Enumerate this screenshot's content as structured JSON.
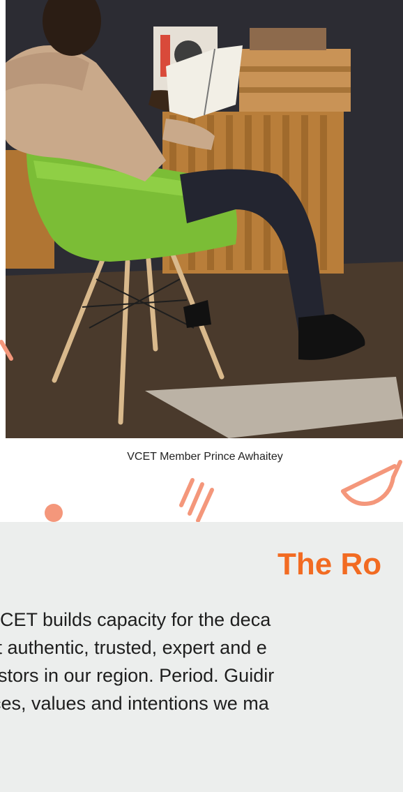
{
  "photo": {
    "alt": "Man reading a book in a green chair",
    "icon": "photo"
  },
  "caption": "VCET Member Prince Awhaitey",
  "section": {
    "title": "The Ro",
    "body_lines": [
      "VCET builds capacity for the deca",
      "st authentic, trusted, expert and e",
      "estors in our region. Period. Guidir",
      "ices, values and intentions we ma"
    ]
  },
  "colors": {
    "accent": "#f26b22",
    "decor": "#f4977b",
    "section_bg": "#eceeed"
  }
}
